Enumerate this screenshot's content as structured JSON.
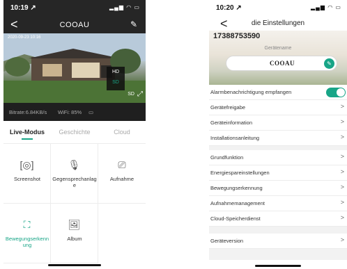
{
  "left": {
    "status": {
      "time": "10:19 ↗",
      "icons": "▂▄▆ ◠ ▭"
    },
    "nav": {
      "back": "<",
      "brand": "COOAU",
      "edit": "✎"
    },
    "video": {
      "timestamp": "2020-09-23  10:16",
      "quality_hd": "HD",
      "quality_sd": "SD",
      "current_quality": "SD",
      "expand": "⤢"
    },
    "stats": {
      "bitrate": "Bitrate:6.84KB/s",
      "wifi": "WiFi: 85%",
      "battery": "▭"
    },
    "tabs": [
      {
        "label": "Live-Modus"
      },
      {
        "label": "Geschichte"
      },
      {
        "label": "Cloud"
      }
    ],
    "grid": [
      {
        "label": "Screenshot",
        "icon": "screenshot-icon",
        "glyph": "[◎]"
      },
      {
        "label": "Gegensprechanlage",
        "icon": "microphone-icon",
        "glyph": "🎙"
      },
      {
        "label": "Aufnahme",
        "icon": "video-record-icon",
        "glyph": "⎚"
      },
      {
        "label": "Bewegungserkennung",
        "icon": "motion-detection-icon",
        "glyph": "⛶"
      },
      {
        "label": "Album",
        "icon": "album-icon",
        "glyph": "🖼"
      }
    ],
    "accent": "#18a587"
  },
  "right": {
    "status": {
      "time": "10:20 ↗",
      "icons": "▂▄▆ ◠ ▭"
    },
    "nav": {
      "back": "<",
      "title": "die Einstellungen"
    },
    "header": {
      "phone": "17388753590",
      "name_caption": "Gerätename",
      "device_name": "COOAU"
    },
    "rows_group1": [
      {
        "label": "Alarmbenachrichtigung empfangen",
        "toggle": true
      },
      {
        "label": "Gerätefreigabe"
      },
      {
        "label": "Geräteinformation"
      },
      {
        "label": "Installationsanleitung"
      }
    ],
    "rows_group2": [
      {
        "label": "Grundfunktion"
      },
      {
        "label": "Energiespareinstellungen"
      },
      {
        "label": "Bewegungserkennung"
      },
      {
        "label": "Aufnahmemanagement"
      },
      {
        "label": "Cloud-Speicherdienst"
      }
    ],
    "rows_group3": [
      {
        "label": "Geräteversion"
      }
    ],
    "chevron": ">"
  }
}
